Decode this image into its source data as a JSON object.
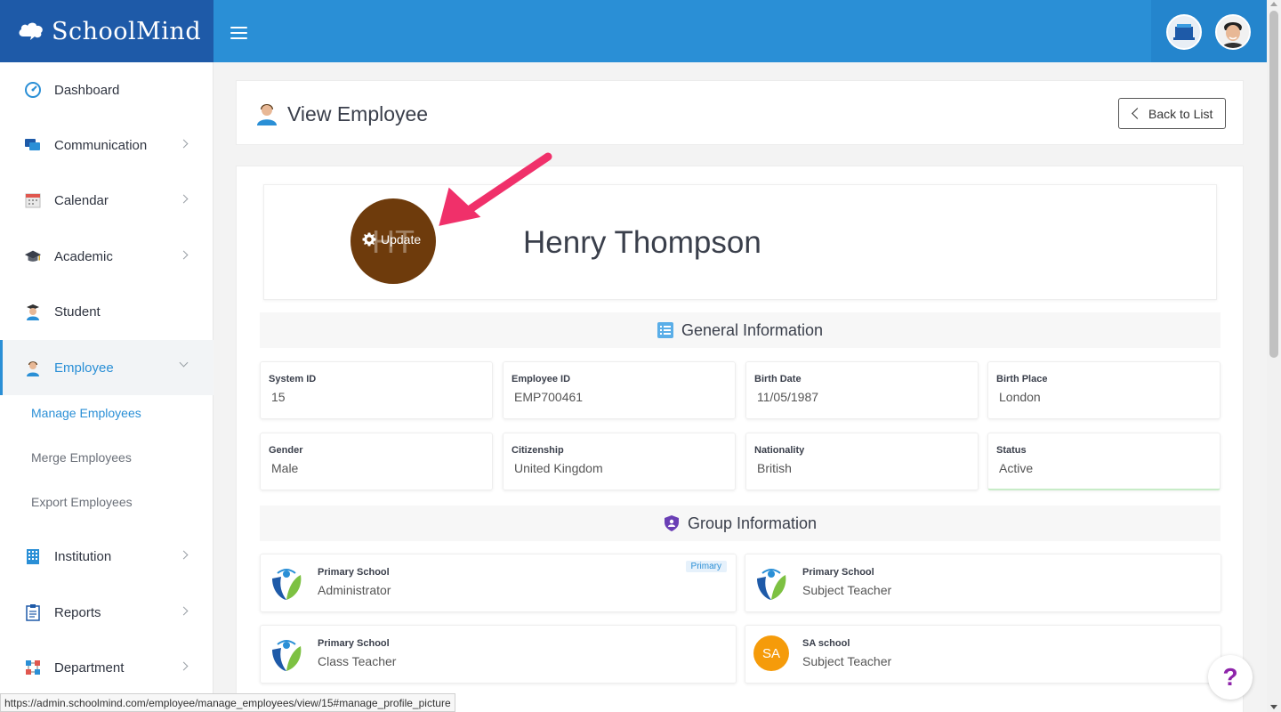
{
  "brand": {
    "name": "SchoolMind"
  },
  "sidebar": {
    "items": [
      {
        "label": "Dashboard",
        "icon": "dashboard-icon",
        "has_children": false
      },
      {
        "label": "Communication",
        "icon": "chat-icon",
        "has_children": true
      },
      {
        "label": "Calendar",
        "icon": "calendar-icon",
        "has_children": true
      },
      {
        "label": "Academic",
        "icon": "graduation-cap-icon",
        "has_children": true
      },
      {
        "label": "Student",
        "icon": "student-icon",
        "has_children": false
      },
      {
        "label": "Employee",
        "icon": "employee-icon",
        "has_children": true,
        "active": true
      },
      {
        "label": "Institution",
        "icon": "building-icon",
        "has_children": true
      },
      {
        "label": "Reports",
        "icon": "clipboard-icon",
        "has_children": true
      },
      {
        "label": "Department",
        "icon": "department-icon",
        "has_children": true
      }
    ],
    "employee_sub": [
      {
        "label": "Manage Employees",
        "active": true
      },
      {
        "label": "Merge Employees"
      },
      {
        "label": "Export Employees"
      }
    ]
  },
  "header": {
    "title": "View Employee",
    "back_label": "Back to List"
  },
  "profile": {
    "initials": "HT",
    "update_label": "Update",
    "name": "Henry Thompson",
    "avatar_color": "#6e3b0c"
  },
  "general": {
    "title": "General Information",
    "fields": [
      {
        "label": "System ID",
        "value": "15"
      },
      {
        "label": "Employee ID",
        "value": "EMP700461"
      },
      {
        "label": "Birth Date",
        "value": "11/05/1987"
      },
      {
        "label": "Birth Place",
        "value": "London"
      },
      {
        "label": "Gender",
        "value": "Male"
      },
      {
        "label": "Citizenship",
        "value": "United Kingdom"
      },
      {
        "label": "Nationality",
        "value": "British"
      },
      {
        "label": "Status",
        "value": "Active"
      }
    ]
  },
  "groups": {
    "title": "Group Information",
    "items": [
      {
        "school": "Primary School",
        "role": "Administrator",
        "badge": "Primary",
        "logo": "school-logo"
      },
      {
        "school": "Primary School",
        "role": "Subject Teacher",
        "logo": "school-logo"
      },
      {
        "school": "Primary School",
        "role": "Class Teacher",
        "logo": "school-logo"
      },
      {
        "school": "SA school",
        "role": "Subject Teacher",
        "logo": "initials",
        "initials": "SA"
      }
    ]
  },
  "help": {
    "label": "?"
  },
  "status_url": "https://admin.schoolmind.com/employee/manage_employees/view/15#manage_profile_picture",
  "colors": {
    "primary": "#2a8fd6",
    "brand_dark": "#1e5aa8",
    "arrow": "#f0306a",
    "sa_badge": "#f59b0a"
  }
}
